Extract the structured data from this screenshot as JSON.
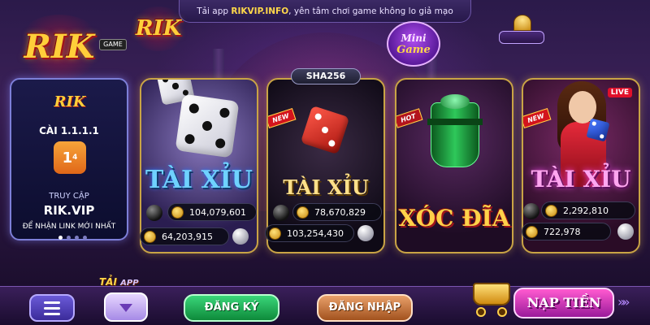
{
  "top_banner": {
    "prefix": "Tải app ",
    "highlight": "RIKVIP.INFO",
    "suffix": ", yên tâm chơi game không lo giả mạo"
  },
  "logos": {
    "main": "RIK",
    "sub": "RIK",
    "game_badge": "GAME",
    "mini_game_line1": "Mini",
    "mini_game_line2": "Game"
  },
  "promo": {
    "logo": "RIK",
    "title": "CÀI 1.1.1.1",
    "dns_main": "1",
    "dns_sup": "4",
    "line1": "TRUY CẬP",
    "line2": "RIK.VIP",
    "line3": "ĐỂ NHẬN LINK MỚI NHẤT"
  },
  "games": [
    {
      "name": "TÀI XỈU",
      "stat_top": "104,079,601",
      "stat_bottom": "64,203,915"
    },
    {
      "name": "TÀI XỈU",
      "badge": "SHA256",
      "ribbon": "NEW",
      "stat_top": "78,670,829",
      "stat_bottom": "103,254,430"
    },
    {
      "name": "XÓC ĐĨA",
      "ribbon": "HOT"
    },
    {
      "name": "TÀI XỈU",
      "ribbon": "NEW",
      "live": "LIVE",
      "stat_top": "2,292,810",
      "stat_bottom": "722,978"
    }
  ],
  "bottom": {
    "download_label": "TẢI",
    "download_app": "APP",
    "register": "ĐĂNG KÝ",
    "login": "ĐĂNG NHẬP",
    "deposit": "NẠP TIỀN",
    "arrows": "»»"
  },
  "icons": [
    "menu-icon",
    "download-icon",
    "cart-icon",
    "dice-icon",
    "cup-icon",
    "coin-icon"
  ]
}
